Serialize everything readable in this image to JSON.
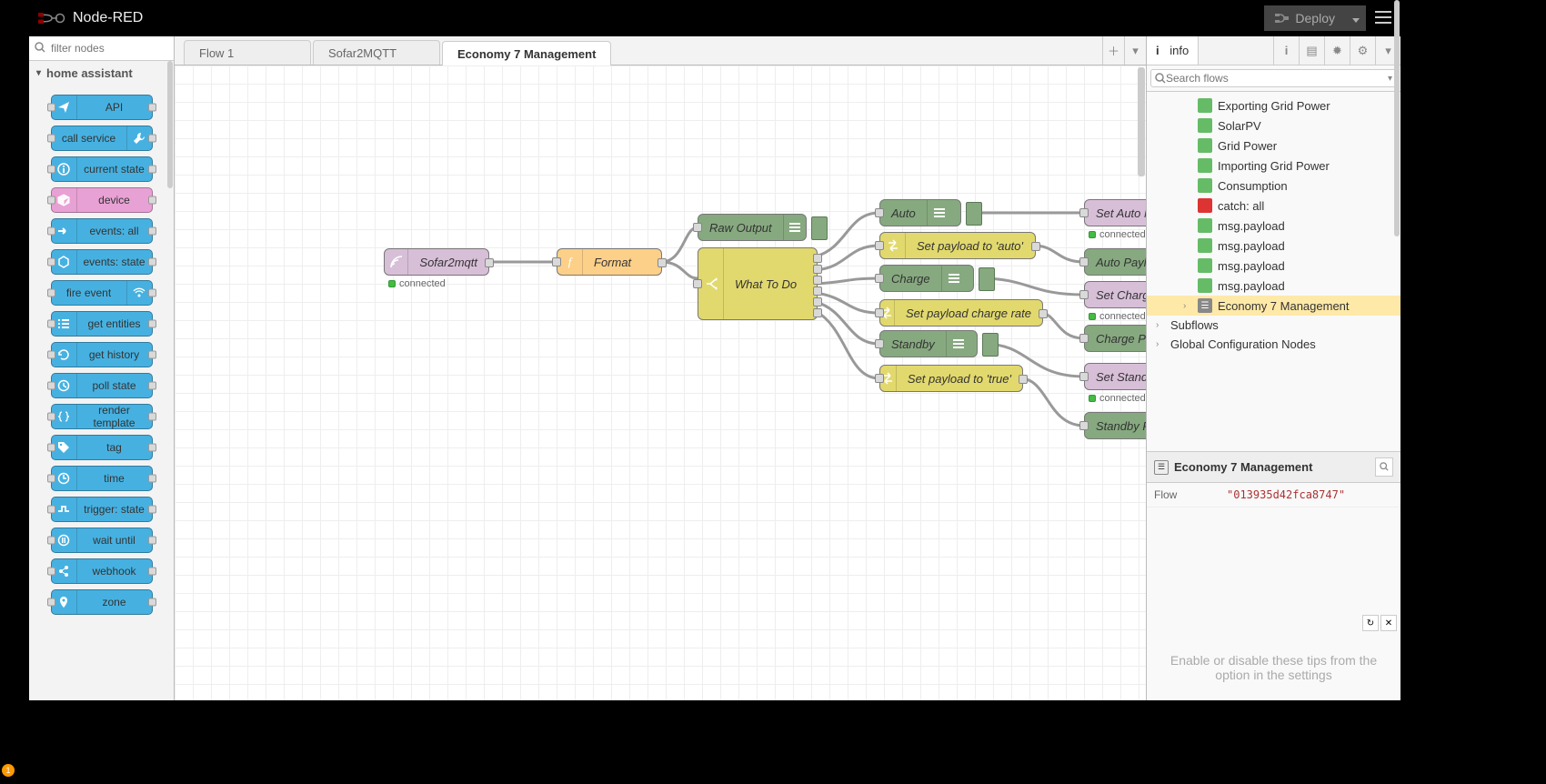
{
  "header": {
    "brand": "Node-RED",
    "deploy_label": "Deploy"
  },
  "palette": {
    "filter_placeholder": "filter nodes",
    "category": "home assistant",
    "nodes": [
      {
        "label": "API",
        "icon": "paper-plane",
        "icon_right": false
      },
      {
        "label": "call service",
        "icon": "wrench",
        "icon_right": true
      },
      {
        "label": "current state",
        "icon": "info",
        "icon_right": false
      },
      {
        "label": "device",
        "icon": "cube",
        "icon_right": false,
        "pink": true
      },
      {
        "label": "events: all",
        "icon": "arrow",
        "icon_right": false
      },
      {
        "label": "events: state",
        "icon": "hex",
        "icon_right": false
      },
      {
        "label": "fire event",
        "icon": "broadcast",
        "icon_right": true
      },
      {
        "label": "get entities",
        "icon": "list",
        "icon_right": false
      },
      {
        "label": "get history",
        "icon": "history",
        "icon_right": false
      },
      {
        "label": "poll state",
        "icon": "clock",
        "icon_right": false
      },
      {
        "label": "render template",
        "icon": "braces",
        "icon_right": false
      },
      {
        "label": "tag",
        "icon": "tag",
        "icon_right": false
      },
      {
        "label": "time",
        "icon": "time",
        "icon_right": false
      },
      {
        "label": "trigger: state",
        "icon": "trigger",
        "icon_right": false
      },
      {
        "label": "wait until",
        "icon": "pause",
        "icon_right": false
      },
      {
        "label": "webhook",
        "icon": "link",
        "icon_right": false
      },
      {
        "label": "zone",
        "icon": "pin",
        "icon_right": false
      }
    ]
  },
  "tabs": [
    {
      "label": "Flow 1",
      "active": false
    },
    {
      "label": "Sofar2MQTT",
      "active": false
    },
    {
      "label": "Economy 7 Management",
      "active": true
    }
  ],
  "flow_nodes": {
    "sofar": {
      "label": "Sofar2mqtt",
      "status": "connected"
    },
    "format": {
      "label": "Format"
    },
    "raw": {
      "label": "Raw Output"
    },
    "wtd": {
      "label": "What To Do"
    },
    "auto": {
      "label": "Auto"
    },
    "pay_auto": {
      "label": "Set payload to 'auto'"
    },
    "charge": {
      "label": "Charge"
    },
    "pay_rate": {
      "label": "Set payload charge rate"
    },
    "standby": {
      "label": "Standby"
    },
    "pay_true": {
      "label": "Set payload to 'true'"
    },
    "set_auto": {
      "label": "Set Auto Mode",
      "status": "connected"
    },
    "auto_pl": {
      "label": "Auto Payload"
    },
    "set_charge": {
      "label": "Set Charge Mode",
      "status": "connected"
    },
    "charge_pl": {
      "label": "Charge Payload"
    },
    "set_standby": {
      "label": "Set Standby Mode",
      "status": "connected"
    },
    "standby_pl": {
      "label": "Standby Payload"
    }
  },
  "sidebar": {
    "tab_label": "info",
    "search_placeholder": "Search flows",
    "tree": [
      {
        "label": "Exporting Grid Power",
        "icon": "green",
        "indent": 1
      },
      {
        "label": "SolarPV",
        "icon": "green",
        "indent": 1
      },
      {
        "label": "Grid Power",
        "icon": "green",
        "indent": 1
      },
      {
        "label": "Importing Grid Power",
        "icon": "green",
        "indent": 1
      },
      {
        "label": "Consumption",
        "icon": "green",
        "indent": 1
      },
      {
        "label": "catch: all",
        "icon": "red",
        "indent": 1
      },
      {
        "label": "msg.payload",
        "icon": "green",
        "indent": 1
      },
      {
        "label": "msg.payload",
        "icon": "green",
        "indent": 1
      },
      {
        "label": "msg.payload",
        "icon": "green",
        "indent": 1
      },
      {
        "label": "msg.payload",
        "icon": "green",
        "indent": 1
      },
      {
        "label": "Economy 7 Management",
        "icon": "flow",
        "indent": 1,
        "selected": true,
        "chev": true
      },
      {
        "label": "Subflows",
        "indent": 0,
        "chev": true
      },
      {
        "label": "Global Configuration Nodes",
        "indent": 0,
        "chev": true
      }
    ],
    "info": {
      "title": "Economy 7 Management",
      "row_key": "Flow",
      "row_val": "\"013935d42fca8747\""
    },
    "tip": "Enable or disable these tips from the option in the settings"
  },
  "badge": "1"
}
